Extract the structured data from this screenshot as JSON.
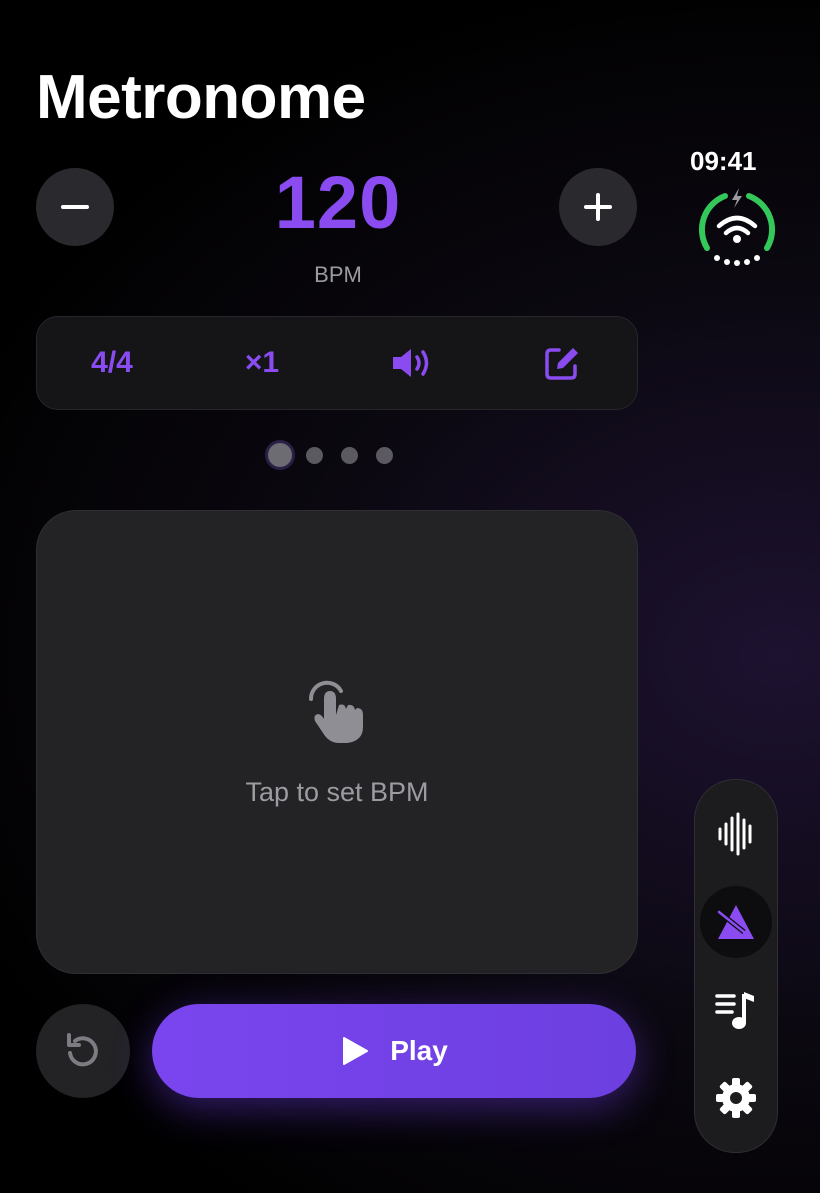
{
  "app": {
    "title": "Metronome"
  },
  "status": {
    "time": "09:41",
    "ring_color": "#34c759"
  },
  "tempo": {
    "value": "120",
    "unit": "BPM",
    "decrease_icon": "minus-icon",
    "increase_icon": "plus-icon"
  },
  "settings_bar": {
    "time_signature": "4/4",
    "subdivision": "×1",
    "sound_icon": "speaker-wave-icon",
    "edit_icon": "pencil-square-icon"
  },
  "pager": {
    "page_count": 4,
    "active_index": 0
  },
  "tap_pad": {
    "label": "Tap to set BPM",
    "icon": "hand-tap-icon"
  },
  "controls": {
    "reset_icon": "rotate-left-icon",
    "play_label": "Play",
    "play_icon": "play-icon"
  },
  "side_dock": {
    "items": [
      {
        "icon": "waveform-icon",
        "active": false
      },
      {
        "icon": "metronome-icon",
        "active": true
      },
      {
        "icon": "music-list-icon",
        "active": false
      },
      {
        "icon": "gear-icon",
        "active": false
      }
    ]
  },
  "colors": {
    "accent": "#8a4cf0",
    "play_gradient_start": "#7a45ee",
    "play_gradient_end": "#6c3fe0",
    "background": "#000000"
  }
}
